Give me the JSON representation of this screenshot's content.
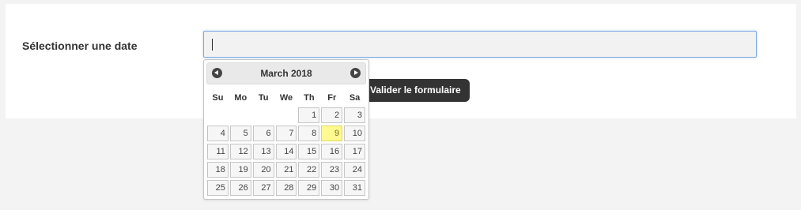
{
  "form": {
    "date_label": "Sélectionner une date",
    "date_value": "",
    "submit_label": "Valider le formulaire"
  },
  "datepicker": {
    "month_title": "March 2018",
    "prev_icon": "circle-triangle-left-icon",
    "next_icon": "circle-triangle-right-icon",
    "weekdays": [
      "Su",
      "Mo",
      "Tu",
      "We",
      "Th",
      "Fr",
      "Sa"
    ],
    "weeks": [
      [
        "",
        "",
        "",
        "",
        "1",
        "2",
        "3"
      ],
      [
        "4",
        "5",
        "6",
        "7",
        "8",
        "9",
        "10"
      ],
      [
        "11",
        "12",
        "13",
        "14",
        "15",
        "16",
        "17"
      ],
      [
        "18",
        "19",
        "20",
        "21",
        "22",
        "23",
        "24"
      ],
      [
        "25",
        "26",
        "27",
        "28",
        "29",
        "30",
        "31"
      ]
    ],
    "highlighted_day": "9"
  }
}
